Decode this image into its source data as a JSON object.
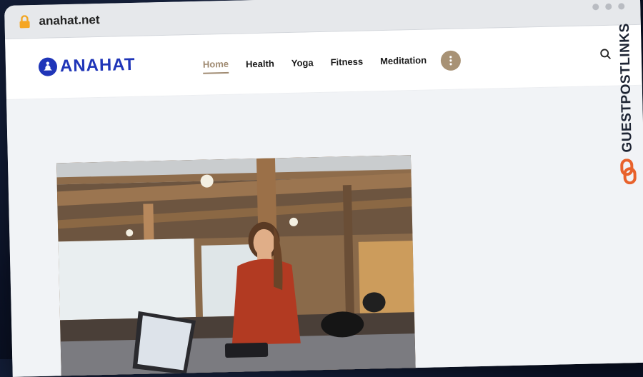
{
  "browser": {
    "url": "anahat.net",
    "icon": "lock-icon"
  },
  "site": {
    "logo_text": "ANAHAT",
    "nav": [
      {
        "label": "Home",
        "active": true
      },
      {
        "label": "Health",
        "active": false
      },
      {
        "label": "Yoga",
        "active": false
      },
      {
        "label": "Fitness",
        "active": false
      },
      {
        "label": "Meditation",
        "active": false
      }
    ],
    "more_icon": "more-vertical-icon",
    "search_icon": "search-icon"
  },
  "hero": {
    "image": "woman-paying-at-cafe-counter"
  },
  "watermark": {
    "text": "GUESTPOSTLINKS"
  },
  "colors": {
    "brand_blue": "#1f35b8",
    "nav_active": "#a08b72",
    "more_button": "#a89275",
    "badge_orange": "#e8622c"
  }
}
